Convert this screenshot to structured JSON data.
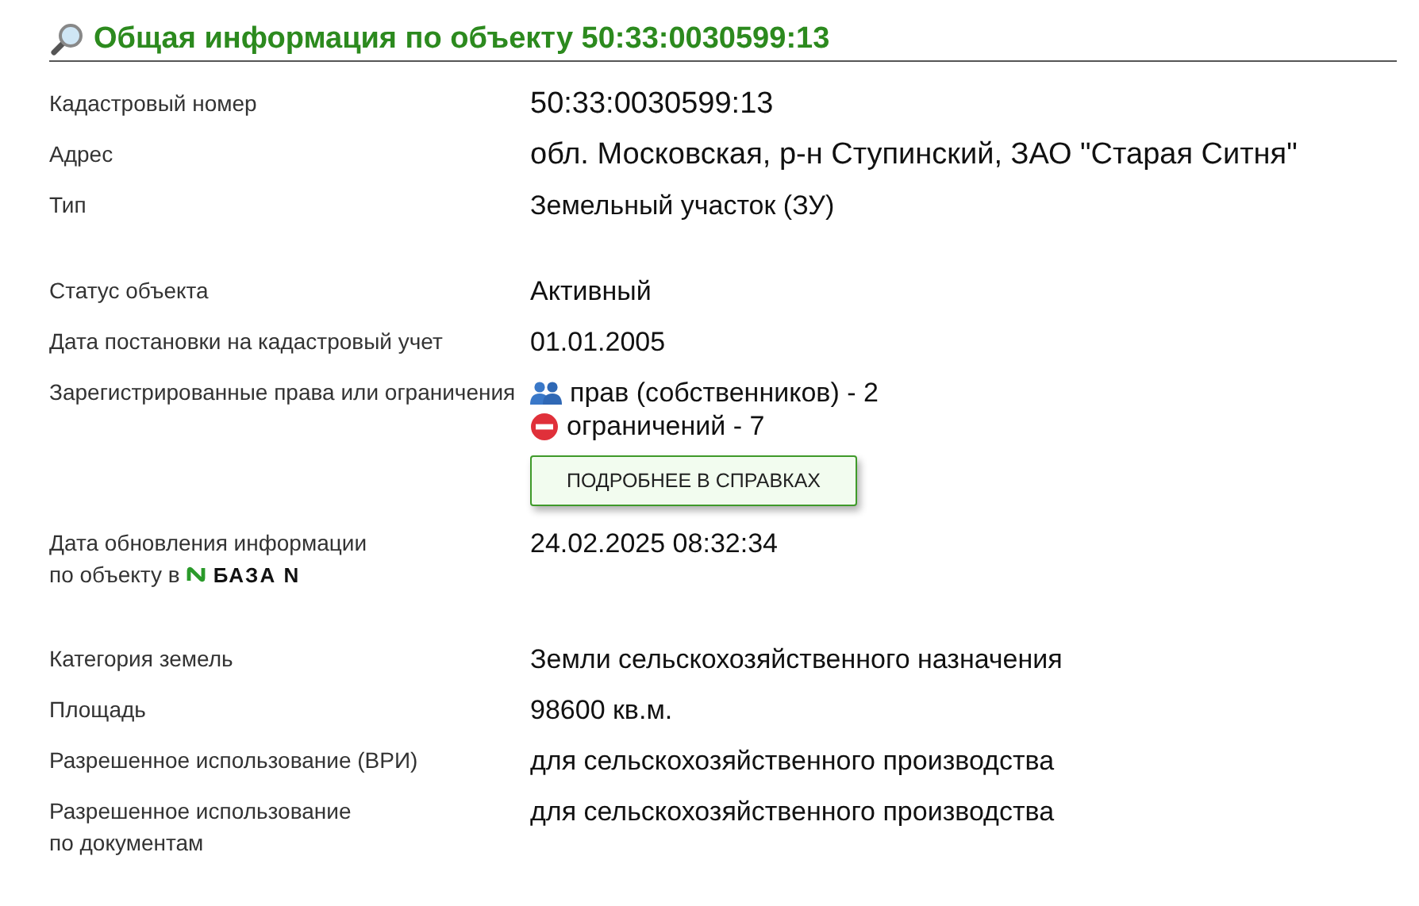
{
  "header": {
    "title": "Общая информация по объекту 50:33:0030599:13"
  },
  "sections": [
    {
      "rows": [
        {
          "kind": "large",
          "label": "Кадастровый номер",
          "value": "50:33:0030599:13"
        },
        {
          "kind": "large",
          "label": "Адрес",
          "value": "обл. Московская, р-н Ступинский, ЗАО \"Старая Ситня\""
        },
        {
          "kind": "text",
          "label": "Тип",
          "value": "Земельный участок (ЗУ)"
        }
      ]
    },
    {
      "rows": [
        {
          "kind": "text",
          "label": "Статус объекта",
          "value": "Активный"
        },
        {
          "kind": "text",
          "label": "Дата постановки на кадастровый учет",
          "value": "01.01.2005"
        },
        {
          "kind": "rights",
          "label": "Зарегистрированные права или ограничения",
          "items": [
            {
              "kind": "people",
              "text": "прав (собственников) - 2"
            },
            {
              "kind": "stop",
              "text": "ограничений - 7"
            }
          ],
          "button": "ПОДРОБНЕЕ В СПРАВКАХ"
        },
        {
          "kind": "update",
          "label": "Дата обновления информации",
          "label_2": "по объекту в",
          "logo": "БАЗА N",
          "value": "24.02.2025 08:32:34"
        }
      ]
    },
    {
      "rows": [
        {
          "kind": "text",
          "label": "Категория земель",
          "value": "Земли сельскохозяйственного назначения"
        },
        {
          "kind": "text",
          "label": "Площадь",
          "value": "98600 кв.м."
        },
        {
          "kind": "text",
          "label": "Разрешенное использование (ВРИ)",
          "value": "для сельскохозяйственного производства"
        },
        {
          "kind": "text",
          "label": "Разрешенное использование",
          "label_2": "по документам",
          "value": "для сельскохозяйственного производства"
        }
      ]
    }
  ]
}
